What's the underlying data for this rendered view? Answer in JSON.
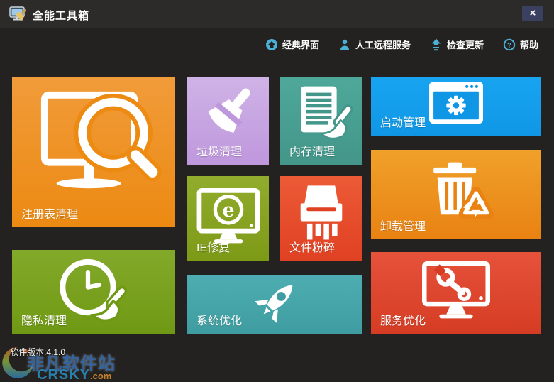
{
  "window": {
    "title": "全能工具箱",
    "close_label": "×"
  },
  "menu": {
    "icon_color": "#4cb0d6",
    "items": [
      {
        "label": "经典界面",
        "icon": "classic-ui-icon"
      },
      {
        "label": "人工远程服务",
        "icon": "remote-service-icon"
      },
      {
        "label": "检查更新",
        "icon": "check-update-icon"
      },
      {
        "label": "帮助",
        "icon": "help-icon"
      }
    ]
  },
  "tiles": [
    {
      "id": "registry",
      "label": "注册表清理",
      "icon": "monitor-magnifier-icon",
      "color_top": "#f19b3a",
      "color_bottom": "#ec8a12"
    },
    {
      "id": "junk",
      "label": "垃圾清理",
      "icon": "broom-icon",
      "color_top": "#cfb3e6",
      "color_bottom": "#bf97dd"
    },
    {
      "id": "memory",
      "label": "内存清理",
      "icon": "document-brush-icon",
      "color_top": "#4ea89a",
      "color_bottom": "#439689"
    },
    {
      "id": "startup",
      "label": "启动管理",
      "icon": "window-gear-icon",
      "color_top": "#18a4f0",
      "color_bottom": "#0f97e6"
    },
    {
      "id": "uninstall",
      "label": "卸载管理",
      "icon": "trash-recycle-icon",
      "color_top": "#f0a12a",
      "color_bottom": "#e98212"
    },
    {
      "id": "ie",
      "label": "IE修复",
      "icon": "monitor-ie-icon",
      "color_top": "#92ac2d",
      "color_bottom": "#7d9a17"
    },
    {
      "id": "shred",
      "label": "文件粉碎",
      "icon": "shredder-icon",
      "color_top": "#ec5a36",
      "color_bottom": "#e04123"
    },
    {
      "id": "privacy",
      "label": "隐私清理",
      "icon": "clock-brush-icon",
      "color_top": "#83a92a",
      "color_bottom": "#6f9914"
    },
    {
      "id": "system",
      "label": "系统优化",
      "icon": "rocket-icon",
      "color_top": "#4dadb1",
      "color_bottom": "#3f9da1"
    },
    {
      "id": "service",
      "label": "服务优化",
      "icon": "monitor-wrench-icon",
      "color_top": "#e6523a",
      "color_bottom": "#d63c24"
    }
  ],
  "footer": {
    "version_label": "软件版本:4.1.0",
    "watermark": {
      "site_name": "非凡软件站",
      "domain_main": "CRSKY",
      "domain_suffix": ".com"
    }
  }
}
